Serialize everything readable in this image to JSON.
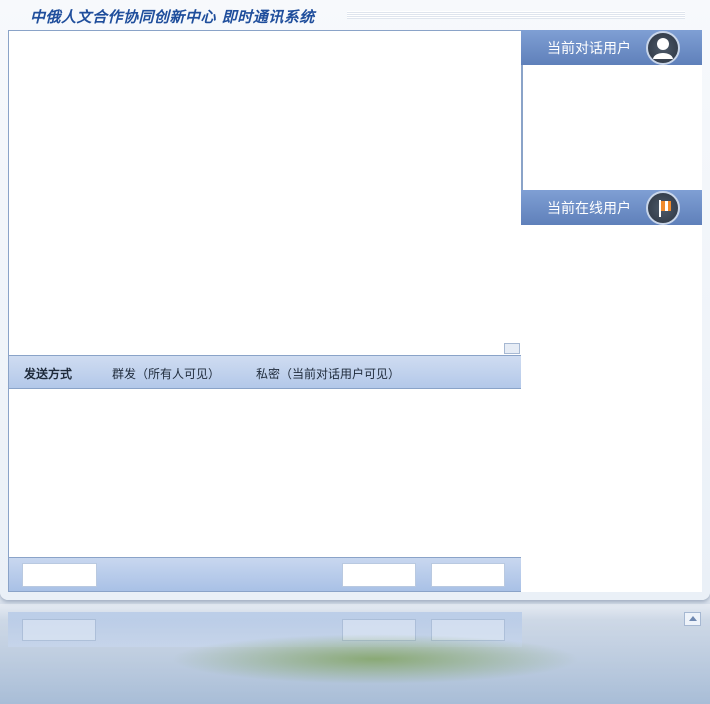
{
  "app": {
    "title": "中俄人文合作协同创新中心 即时通讯系统"
  },
  "send_options": {
    "label": "发送方式",
    "broadcast": "群发（所有人可见）",
    "private": "私密（当前对话用户可见）"
  },
  "buttons": {
    "clear": "",
    "submit": "",
    "close": ""
  },
  "panels": {
    "current_user": {
      "title": "当前对话用户",
      "icon": "user-avatar-icon"
    },
    "online_users": {
      "title": "当前在线用户",
      "icon": "flag-icon"
    }
  },
  "colors": {
    "title": "#1f4e9c",
    "panel_header": "#6f8fc7",
    "bar": "#bccfed"
  }
}
